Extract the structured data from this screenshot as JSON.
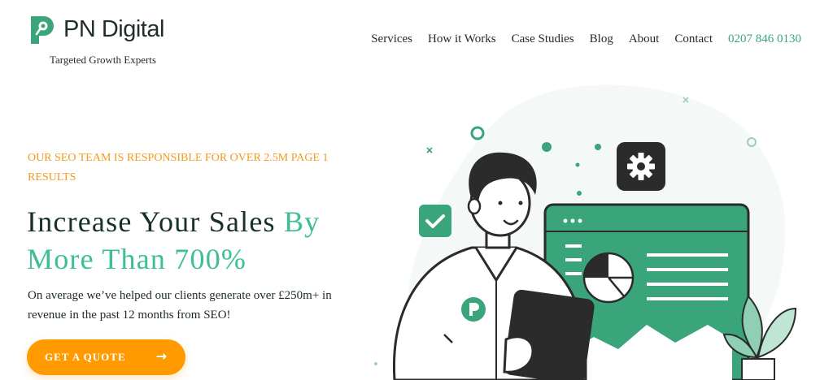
{
  "brand": {
    "name": "PN Digital",
    "tagline": "Targeted Growth Experts"
  },
  "nav": {
    "items": [
      {
        "label": "Services"
      },
      {
        "label": "How it Works"
      },
      {
        "label": "Case Studies"
      },
      {
        "label": "Blog"
      },
      {
        "label": "About"
      },
      {
        "label": "Contact"
      }
    ],
    "phone": "0207 846 0130"
  },
  "hero": {
    "eyebrow": "OUR SEO TEAM IS RESPONSIBLE FOR OVER 2.5M PAGE 1 RESULTS",
    "headline_main": "Increase Your Sales ",
    "headline_accent": "By More Than 700%",
    "description": "On average we’ve helped our clients generate over £250m+ in revenue in the past 12 months from SEO!",
    "cta_label": "GET A QUOTE",
    "cta_icon": "arrow-right-icon"
  },
  "colors": {
    "brand_green": "#3aa57a",
    "accent_mint": "#3bbf93",
    "orange": "#ff9a00",
    "eyebrow_orange": "#f39a1c",
    "dark": "#1f2a2c"
  }
}
